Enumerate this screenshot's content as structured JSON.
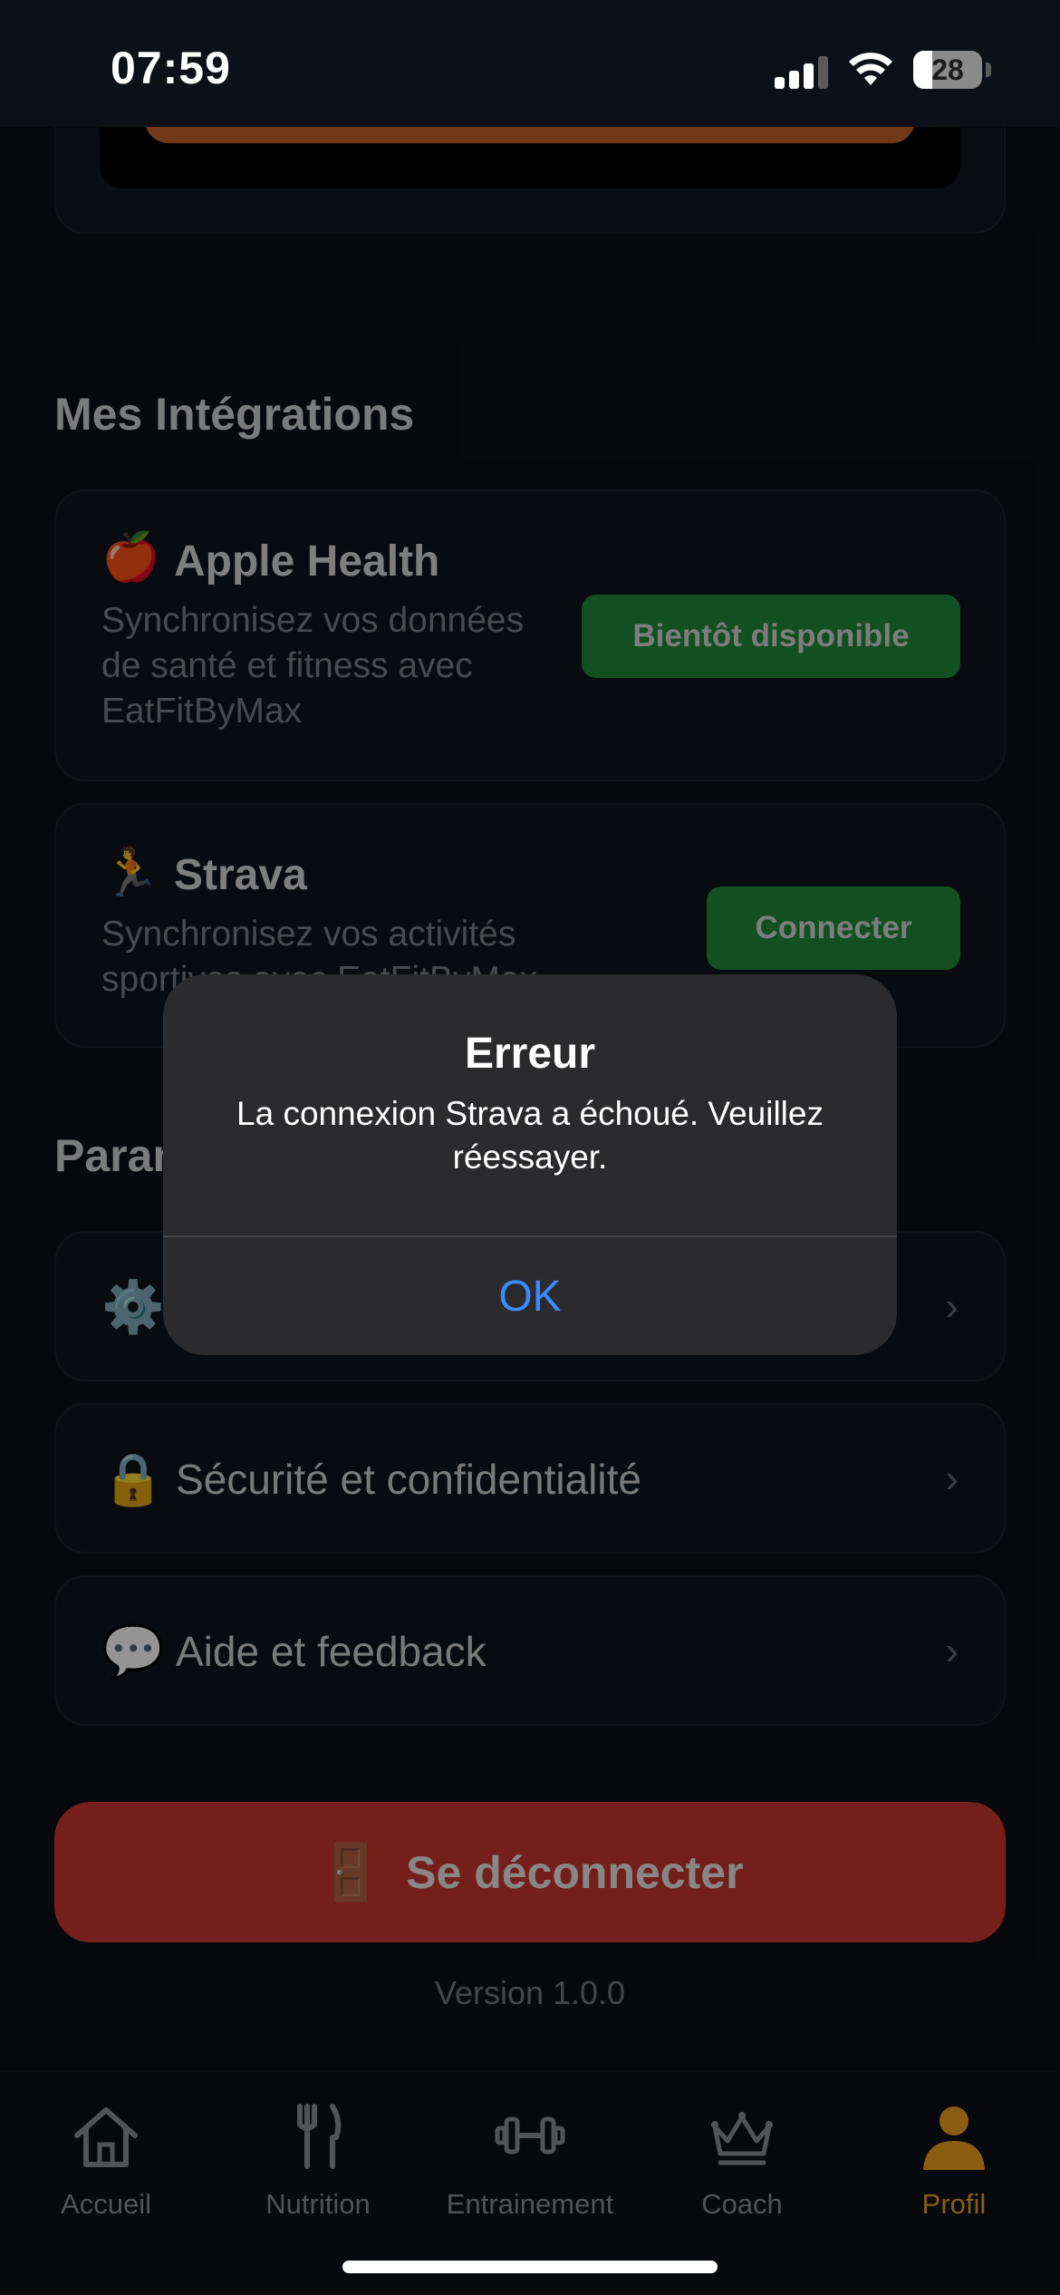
{
  "status_bar": {
    "time": "07:59",
    "battery": "28",
    "battery_level": 0.28
  },
  "integrations": {
    "section_title": "Mes Intégrations",
    "items": [
      {
        "emoji": "🍎",
        "title": "Apple Health",
        "description": "Synchronisez vos données de santé et fitness avec EatFitByMax",
        "button": "Bientôt disponible"
      },
      {
        "emoji": "🏃",
        "title": "Strava",
        "description": "Synchronisez vos activités sportives avec EatFitByMax",
        "button": "Connecter"
      }
    ]
  },
  "settings": {
    "section_title": "Paramètres",
    "rows": [
      {
        "icon": "⚙️",
        "label": ""
      },
      {
        "icon": "🔒",
        "label": "Sécurité et confidentialité"
      },
      {
        "icon": "💬",
        "label": "Aide et feedback"
      }
    ],
    "chevron": "›"
  },
  "logout": {
    "icon": "🚪",
    "label": "Se déconnecter"
  },
  "version": "Version 1.0.0",
  "tabbar": {
    "tabs": [
      {
        "label": "Accueil",
        "icon": "home-icon"
      },
      {
        "label": "Nutrition",
        "icon": "fork-knife-icon"
      },
      {
        "label": "Entrainement",
        "icon": "dumbbell-icon"
      },
      {
        "label": "Coach",
        "icon": "crown-icon"
      },
      {
        "label": "Profil",
        "icon": "person-icon"
      }
    ],
    "active": "Profil"
  },
  "alert": {
    "title": "Erreur",
    "message": "La connexion Strava a échoué. Veuillez réessayer.",
    "ok_label": "OK"
  },
  "colors": {
    "background": "#0d1117",
    "accent_green": "#1f8a3a",
    "logout_red": "#c8362f",
    "active_tab": "#f0a020",
    "alert_button": "#3a8bff"
  }
}
